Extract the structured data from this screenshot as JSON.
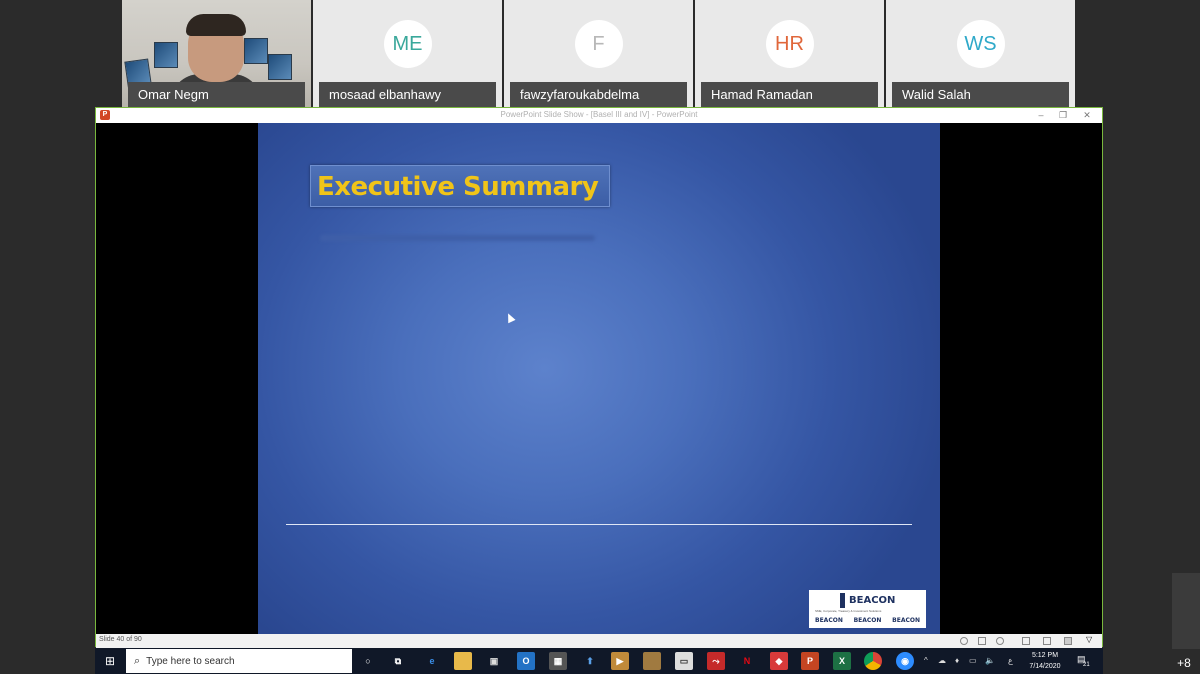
{
  "participants": [
    {
      "name": "Omar Negm",
      "initials": "",
      "video": true
    },
    {
      "name": "mosaad elbanhawy",
      "initials": "ME",
      "color": "#3aa89b"
    },
    {
      "name": "fawzyfaroukabdelma",
      "initials": "F",
      "color": "#b8b8b8"
    },
    {
      "name": "Hamad Ramadan",
      "initials": "HR",
      "color": "#e0673b"
    },
    {
      "name": "Walid Salah",
      "initials": "WS",
      "color": "#2fa9c9"
    }
  ],
  "share": {
    "window_title": "PowerPoint Slide Show - [Basel III and IV] - PowerPoint",
    "app_icon": "P",
    "slide_title": "Executive Summary",
    "logo_main": "BEACON",
    "logo_tagline": "SME, Corporate, Treasury & Investment Solutions",
    "logo_row": [
      "BEACON",
      "BEACON",
      "BEACON"
    ],
    "status_slide": "Slide 40 of 90"
  },
  "taskbar": {
    "search_placeholder": "Type here to search",
    "time": "5:12 PM",
    "date": "7/14/2020",
    "lang": "ع",
    "notif_count": "21"
  },
  "overflow_count": "+8",
  "colors": {
    "share_border": "#79b83d",
    "title_yellow": "#f0c419",
    "slide_blue": "#3556a4"
  }
}
